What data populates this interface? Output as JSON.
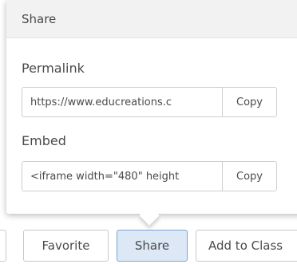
{
  "popover": {
    "title": "Share",
    "permalink": {
      "label": "Permalink",
      "value": "https://www.educreations.c",
      "copy_label": "Copy"
    },
    "embed": {
      "label": "Embed",
      "value": "<iframe width=\"480\" height",
      "copy_label": "Copy"
    }
  },
  "toolbar": {
    "favorite_label": "Favorite",
    "share_label": "Share",
    "add_to_class_label": "Add to Class"
  },
  "colors": {
    "header_bg": "#f2f2f2",
    "active_button_bg": "#dce8f5",
    "active_button_border": "#7aa5d6"
  }
}
